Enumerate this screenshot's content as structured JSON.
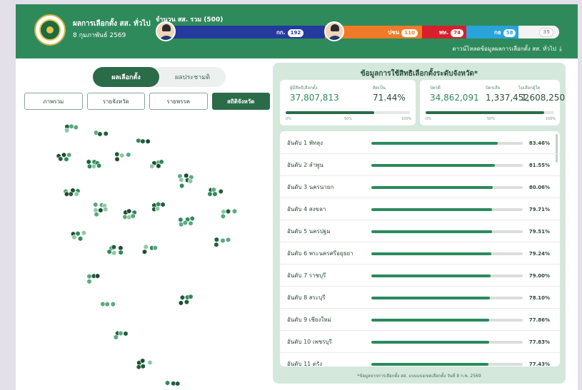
{
  "header": {
    "title": "ผลการเลือกตั้ง สส. ทั่วไป",
    "date": "8 กุมภาพันธ์ 2569",
    "seat_total": "จำนวน สส. รวม (500)",
    "download_label": "ดาวน์โหลดข้อมูลผลการเลือกตั้ง สส. ทั่วไป",
    "parties": [
      {
        "name": "กก.",
        "seats": 192,
        "color": "#243a9c"
      },
      {
        "name": "ปชน",
        "seats": 110,
        "color": "#ef7a28"
      },
      {
        "name": "พท.",
        "seats": 74,
        "color": "#d6202c"
      },
      {
        "name": "กธ",
        "seats": 58,
        "color": "#2aa3da"
      },
      {
        "name": "",
        "seats": 35,
        "color": "#f3f3f3"
      }
    ]
  },
  "left": {
    "toggle": [
      "ผลเลือกตั้ง",
      "ผลประชามติ"
    ],
    "tabs": [
      "ภาพรวม",
      "รายจังหวัด",
      "รายพรรค",
      "สถิติจังหวัด"
    ]
  },
  "panel": {
    "title": "ข้อมูลการใช้สิทธิเลือกตั้งระดับจังหวัด*",
    "turnout": {
      "eligible_label": "ผู้มีสิทธิเลือกตั้ง",
      "eligible_value": "37,807,813",
      "percent_label": "คิดเป็น",
      "percent_value": "71.44%",
      "fraction": 0.7144
    },
    "ballots": {
      "valid_label": "บัตรดี",
      "valid_value": "34,862,091",
      "invalid_label": "บัตรเสีย",
      "invalid_value": "1,337,452",
      "novote_label": "ไม่เลือกผู้ใด",
      "novote_value": "1,608,250",
      "fraction": 0.92
    },
    "scale": {
      "min": "0%",
      "mid": "50%",
      "max": "100%"
    },
    "ranks": [
      {
        "label": "อันดับ 1  พัทลุง",
        "pct": "83.46%",
        "value": 83.46
      },
      {
        "label": "อันดับ 2  ลำพูน",
        "pct": "81.55%",
        "value": 81.55
      },
      {
        "label": "อันดับ 3  นครนายก",
        "pct": "80.06%",
        "value": 80.06
      },
      {
        "label": "อันดับ 4  สงขลา",
        "pct": "79.71%",
        "value": 79.71
      },
      {
        "label": "อันดับ 5  นครปฐม",
        "pct": "79.51%",
        "value": 79.51
      },
      {
        "label": "อันดับ 6  พระนครศรีอยุธยา",
        "pct": "79.24%",
        "value": 79.24
      },
      {
        "label": "อันดับ 7  ราชบุรี",
        "pct": "79.00%",
        "value": 79.0
      },
      {
        "label": "อันดับ 8  สระบุรี",
        "pct": "78.10%",
        "value": 78.1
      },
      {
        "label": "อันดับ 9  เชียงใหม่",
        "pct": "77.86%",
        "value": 77.86
      },
      {
        "label": "อันดับ 10  เพชรบุรี",
        "pct": "77.83%",
        "value": 77.83
      },
      {
        "label": "อันดับ 11  ตรัง",
        "pct": "77.43%",
        "value": 77.43
      }
    ],
    "footnote": "*ข้อมูลจากการเลือกตั้ง สส. แบบแบ่งเขตเลือกตั้ง วันที่ 8 ก.พ. 2569"
  }
}
